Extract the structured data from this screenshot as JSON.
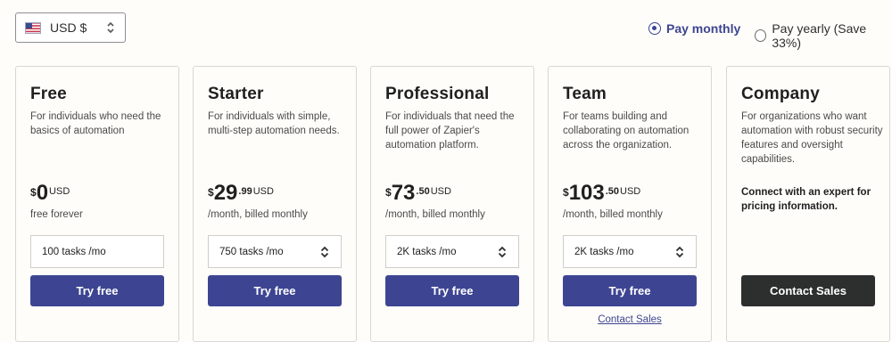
{
  "currency": {
    "label": "USD $"
  },
  "billing": {
    "monthly": "Pay monthly",
    "yearly": "Pay yearly (Save 33%)",
    "selected": "monthly"
  },
  "plans": [
    {
      "name": "Free",
      "desc": "For individuals who need the basics of automation",
      "currency_symbol": "$",
      "price_int": "0",
      "price_dec": "",
      "price_code": "USD",
      "billing_note": "free forever",
      "tasks": "100 tasks /mo",
      "button": "Try free"
    },
    {
      "name": "Starter",
      "desc": "For individuals with simple, multi-step automation needs.",
      "currency_symbol": "$",
      "price_int": "29",
      "price_dec": ".99",
      "price_code": "USD",
      "billing_note": "/month, billed monthly",
      "tasks": "750 tasks /mo",
      "button": "Try free"
    },
    {
      "name": "Professional",
      "desc": "For individuals that need the full power of Zapier's automation platform.",
      "currency_symbol": "$",
      "price_int": "73",
      "price_dec": ".50",
      "price_code": "USD",
      "billing_note": "/month, billed monthly",
      "tasks": "2K tasks /mo",
      "button": "Try free"
    },
    {
      "name": "Team",
      "desc": "For teams building and collaborating on automation across the organization.",
      "currency_symbol": "$",
      "price_int": "103",
      "price_dec": ".50",
      "price_code": "USD",
      "billing_note": "/month, billed monthly",
      "tasks": "2K tasks /mo",
      "button": "Try free",
      "secondary_link": "Contact Sales"
    },
    {
      "name": "Company",
      "desc": "For organizations who want automation with robust security features and oversight capabilities.",
      "contact_text": "Connect with an expert for pricing information.",
      "button": "Contact Sales"
    }
  ],
  "colors": {
    "primary": "#3d4592",
    "dark_button": "#2d2e2e",
    "background": "#fffdf9",
    "border": "#d9d7d2"
  }
}
